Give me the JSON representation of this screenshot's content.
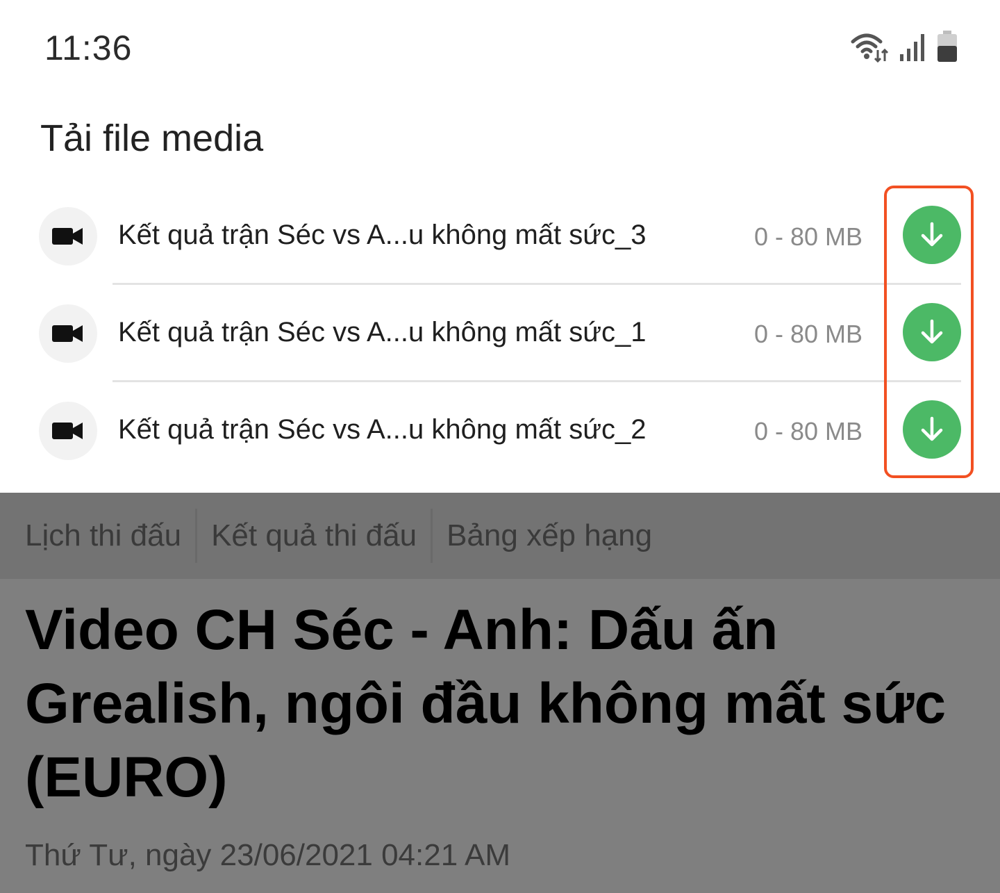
{
  "status_bar": {
    "time": "11:36",
    "icons": [
      "wifi-icon",
      "signal-icon",
      "battery-icon"
    ]
  },
  "sheet": {
    "title": "Tải file media",
    "items": [
      {
        "name": "Kết quả trận Séc vs A...u không mất sức_3",
        "size": "0 - 80 MB",
        "icon": "video-camera-icon",
        "action_icon": "download-arrow-icon"
      },
      {
        "name": "Kết quả trận Séc vs A...u không mất sức_1",
        "size": "0 - 80 MB",
        "icon": "video-camera-icon",
        "action_icon": "download-arrow-icon"
      },
      {
        "name": "Kết quả trận Séc vs A...u không mất sức_2",
        "size": "0 - 80 MB",
        "icon": "video-camera-icon",
        "action_icon": "download-arrow-icon"
      }
    ]
  },
  "page": {
    "nav": [
      "Lịch thi đấu",
      "Kết quả thi đấu",
      "Bảng xếp hạng"
    ],
    "article_title": "Video CH Séc - Anh: Dấu ấn Grealish, ngôi đầu không mất sức (EURO)",
    "article_date": "Thứ Tư, ngày 23/06/2021 04:21 AM"
  },
  "colors": {
    "download_green": "#4cb966",
    "highlight": "#f25022",
    "overlay": "#7f7f7f"
  }
}
